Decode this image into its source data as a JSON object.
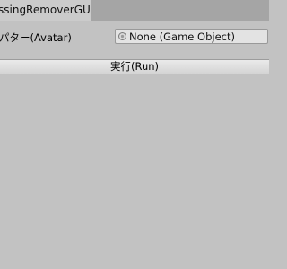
{
  "window": {
    "tab_title": "ssingRemoverGUI"
  },
  "avatar_field": {
    "label": "パター(Avatar)",
    "value": "None (Game Object)",
    "icon": "game-object-icon"
  },
  "run_button": {
    "label": "実行(Run)"
  },
  "colors": {
    "background": "#c2c2c2",
    "tab_bar": "#a5a5a5",
    "active_tab": "#cbcbcb",
    "field_background": "#e3e3e3"
  }
}
